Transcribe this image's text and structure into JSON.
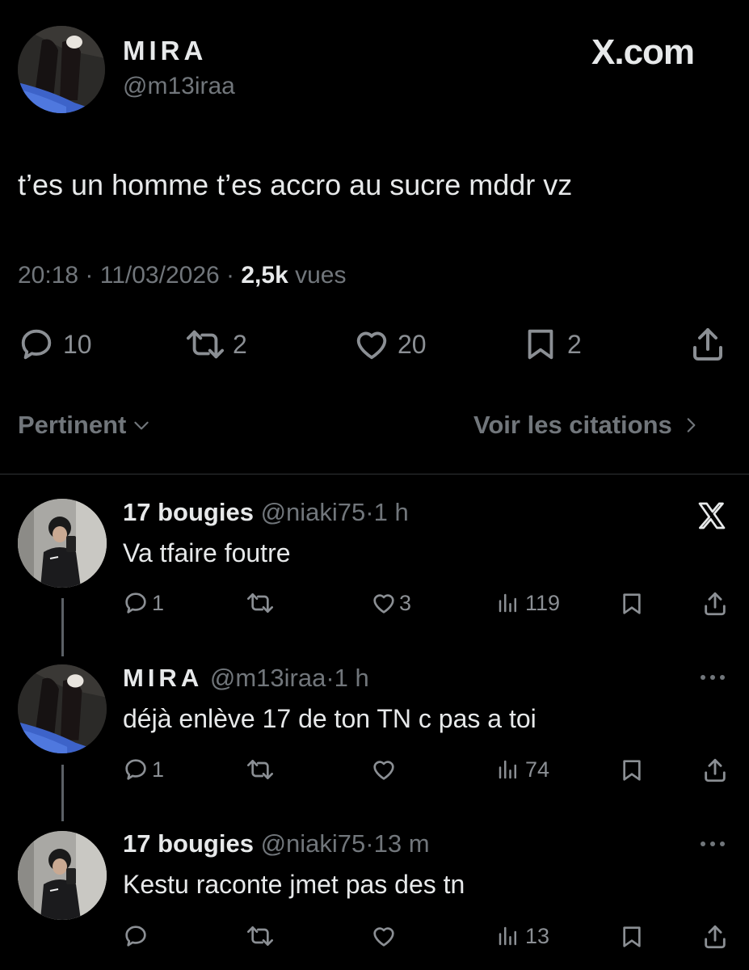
{
  "main_tweet": {
    "display_name": "MIRA",
    "handle": "@m13iraa",
    "brand": "X.com",
    "text": "t’es un homme t’es accro au sucre mddr vz",
    "time": "20:18",
    "date": "11/03/2026",
    "views_count": "2,5k",
    "views_label": "vues",
    "sep": "·",
    "replies": "10",
    "reposts": "2",
    "likes": "20",
    "bookmarks": "2"
  },
  "sort": {
    "label": "Pertinent",
    "quotes_link": "Voir les citations"
  },
  "replies": [
    {
      "display_name": "17 bougies",
      "handle": "@niaki75",
      "sep": "·",
      "time": "1 h",
      "text": "Va tfaire foutre",
      "replies": "1",
      "likes": "3",
      "views": "119",
      "corner_icon": "x-logo-icon"
    },
    {
      "display_name": "MIRA",
      "handle": "@m13iraa",
      "sep": "·",
      "time": "1 h",
      "text": "déjà enlève 17 de ton TN c pas a toi",
      "replies": "1",
      "likes": "",
      "views": "74",
      "corner_icon": "more-icon"
    },
    {
      "display_name": "17 bougies",
      "handle": "@niaki75",
      "sep": "·",
      "time": "13 m",
      "text": "Kestu raconte jmet pas des tn",
      "replies": "",
      "likes": "",
      "views": "13",
      "corner_icon": "more-icon"
    }
  ]
}
